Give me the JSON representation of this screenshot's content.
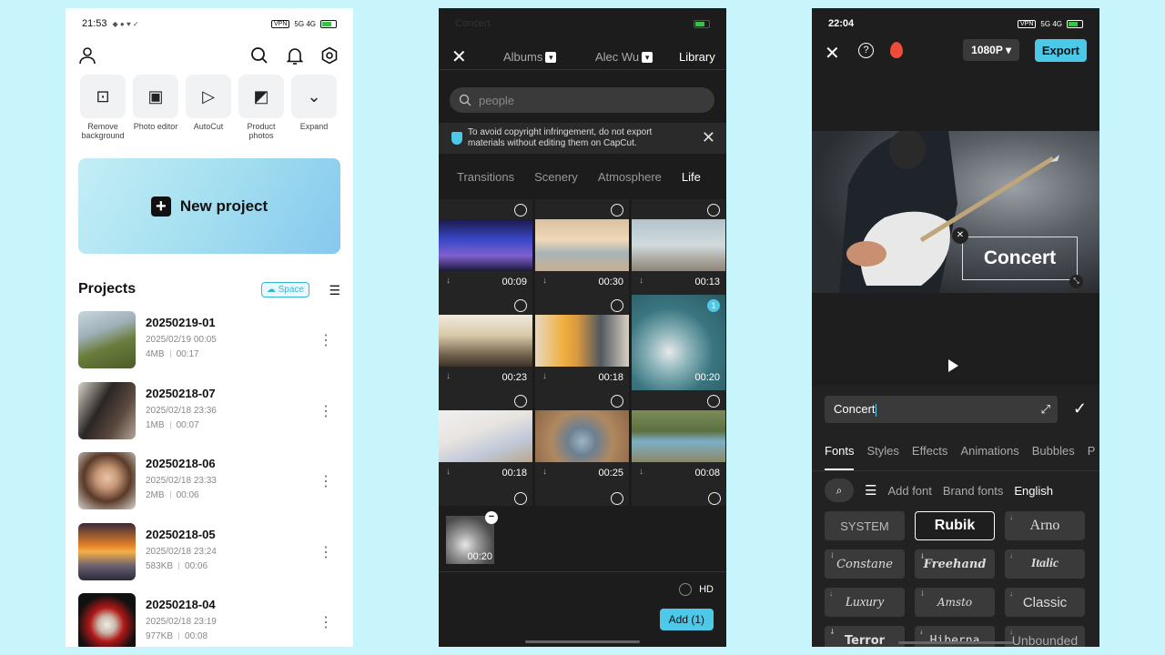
{
  "phone1": {
    "status": {
      "time": "21:53",
      "icons_left": "◆ ● ♥ ✓",
      "vpn": "VPN",
      "signal": "5G 4G"
    },
    "tools": [
      {
        "label": "Remove background",
        "icon": "person-cutout-icon"
      },
      {
        "label": "Photo editor",
        "icon": "photo-editor-icon"
      },
      {
        "label": "AutoCut",
        "icon": "autocut-icon"
      },
      {
        "label": "Product photos",
        "icon": "product-ai-icon"
      },
      {
        "label": "Expand",
        "icon": "chevron-down-icon"
      }
    ],
    "new_project_label": "New project",
    "projects_title": "Projects",
    "space_label": "Space",
    "projects": [
      {
        "name": "20250219-01",
        "date": "2025/02/19 00:05",
        "size": "4MB",
        "duration": "00:17"
      },
      {
        "name": "20250218-07",
        "date": "2025/02/18 23:36",
        "size": "1MB",
        "duration": "00:07"
      },
      {
        "name": "20250218-06",
        "date": "2025/02/18 23:33",
        "size": "2MB",
        "duration": "00:06"
      },
      {
        "name": "20250218-05",
        "date": "2025/02/18 23:24",
        "size": "583KB",
        "duration": "00:06"
      },
      {
        "name": "20250218-04",
        "date": "2025/02/18 23:19",
        "size": "977KB",
        "duration": "00:08"
      }
    ]
  },
  "phone2": {
    "status": {
      "time": "Concert"
    },
    "tabs": {
      "albums": "Albums",
      "user": "Alec Wu",
      "library": "Library"
    },
    "search_placeholder": "people",
    "notice": "To avoid copyright infringement, do not export materials without editing them on CapCut.",
    "categories": [
      "Transitions",
      "Scenery",
      "Atmosphere",
      "Life"
    ],
    "clips": [
      {
        "duration": "00:09",
        "selected": false
      },
      {
        "duration": "00:30",
        "selected": false
      },
      {
        "duration": "00:13",
        "selected": false
      },
      {
        "duration": "00:23",
        "selected": false
      },
      {
        "duration": "00:18",
        "selected": false
      },
      {
        "duration": "00:20",
        "selected": true,
        "badge": "1"
      },
      {
        "duration": "00:18",
        "selected": false
      },
      {
        "duration": "00:25",
        "selected": false
      },
      {
        "duration": "00:08",
        "selected": false
      }
    ],
    "tray_duration": "00:20",
    "hd_label": "HD",
    "add_button": "Add (1)"
  },
  "phone3": {
    "status": {
      "time": "22:04",
      "vpn": "VPN",
      "signal": "5G 4G"
    },
    "resolution": "1080P",
    "export_label": "Export",
    "overlay_text": "Concert",
    "input_value": "Concert",
    "tabs": [
      "Fonts",
      "Styles",
      "Effects",
      "Animations",
      "Bubbles",
      "P"
    ],
    "font_toolbar": {
      "add_font": "Add font",
      "brand_fonts": "Brand fonts",
      "language": "English"
    },
    "fonts": [
      "SYSTEM",
      "Rubik",
      "Arno",
      "Constane",
      "Freehand",
      "Italic",
      "Luxury",
      "Amsto",
      "Classic",
      "Terror",
      "Hiberna",
      "Unbounded"
    ],
    "accent": "#4cc8e8"
  }
}
